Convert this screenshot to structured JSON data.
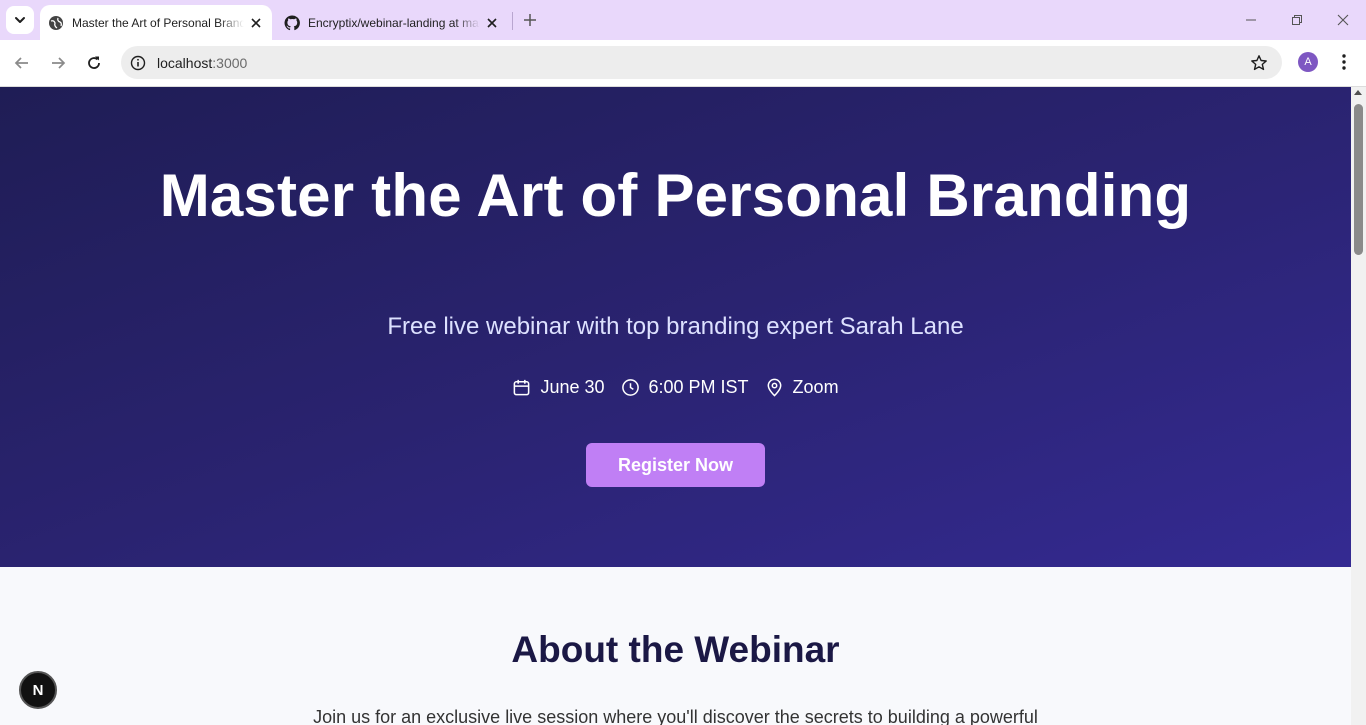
{
  "browser": {
    "tabs": [
      {
        "title": "Master the Art of Personal Branding",
        "icon": "globe-icon",
        "active": true
      },
      {
        "title": "Encryptix/webinar-landing at main",
        "icon": "github-icon",
        "active": false
      }
    ],
    "url_host": "localhost",
    "url_port": ":3000",
    "profile_initial": "A",
    "colors": {
      "tabbar": "#e9d8fb",
      "profile": "#7e57c2"
    }
  },
  "hero": {
    "title": "Master the Art of Personal Branding",
    "subtitle": "Free live webinar with top branding expert Sarah Lane",
    "date": "June 30",
    "time": "6:00 PM IST",
    "location": "Zoom",
    "cta_label": "Register Now",
    "colors": {
      "background": "#2a2370",
      "cta": "#c07ff5"
    }
  },
  "about": {
    "heading": "About the Webinar",
    "text": "Join us for an exclusive live session where you'll discover the secrets to building a powerful"
  },
  "dev_badge": {
    "label": "N"
  }
}
